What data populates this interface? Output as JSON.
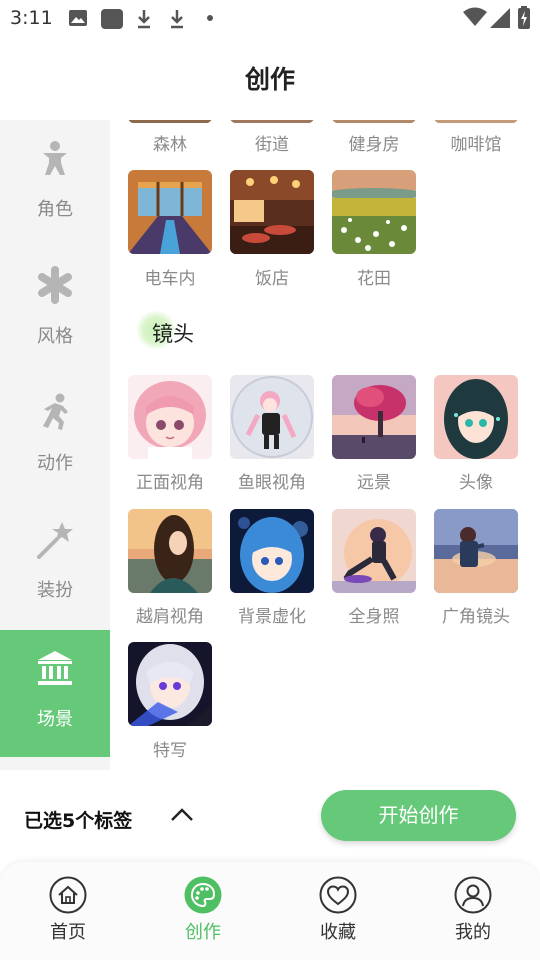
{
  "status_bar": {
    "time": "3:11"
  },
  "page_title": "创作",
  "sidebar": {
    "items": [
      {
        "label": "角色",
        "icon": "person-icon"
      },
      {
        "label": "风格",
        "icon": "asterisk-icon"
      },
      {
        "label": "动作",
        "icon": "running-icon"
      },
      {
        "label": "装扮",
        "icon": "magic-wand-icon"
      },
      {
        "label": "场景",
        "icon": "building-icon",
        "active": true
      }
    ]
  },
  "scene_tags": {
    "top_row": [
      "森林",
      "街道",
      "健身房",
      "咖啡馆"
    ],
    "row2": [
      "电车内",
      "饭店",
      "花田"
    ]
  },
  "lens_section": {
    "title": "镜头",
    "row1": [
      "正面视角",
      "鱼眼视角",
      "远景",
      "头像"
    ],
    "row2": [
      "越肩视角",
      "背景虚化",
      "全身照",
      "广角镜头"
    ],
    "row3": [
      "特写"
    ]
  },
  "action_bar": {
    "selected_text": "已选5个标签",
    "start_button": "开始创作"
  },
  "tab_bar": {
    "tabs": [
      {
        "label": "首页",
        "icon": "home-icon"
      },
      {
        "label": "创作",
        "icon": "palette-icon",
        "active": true
      },
      {
        "label": "收藏",
        "icon": "heart-icon"
      },
      {
        "label": "我的",
        "icon": "user-icon"
      }
    ]
  },
  "colors": {
    "accent": "#66c97a",
    "tab_active": "#4fbf63",
    "muted": "#8a8a8a"
  }
}
